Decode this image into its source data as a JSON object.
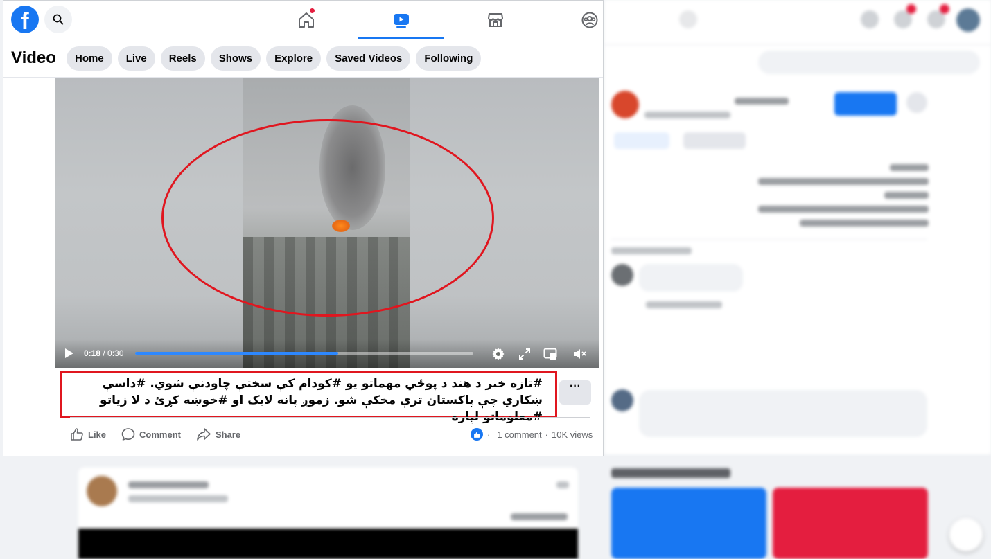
{
  "topnav": {
    "logo": "f",
    "icons": [
      "facebook-logo",
      "search-icon",
      "home-icon",
      "video-icon",
      "marketplace-icon",
      "groups-icon"
    ]
  },
  "subnav": {
    "title": "Video",
    "pills": [
      "Home",
      "Live",
      "Reels",
      "Shows",
      "Explore",
      "Saved Videos",
      "Following"
    ]
  },
  "player": {
    "current_time": "0:18",
    "separator": " / ",
    "duration": "0:30",
    "progress": 0.6
  },
  "post": {
    "caption": "#تازه خبر د هند د پوځي مهماتو يو #کودام کې سختې چاودنې شوي. #داسې ښکاري چې پاکستان ترې مخکې شو. زموږ پانه لايک او #خوښه کړئ د لا زياتو #معلوماتو لپاره",
    "more": "···",
    "actions": {
      "like": "Like",
      "comment": "Comment",
      "share": "Share"
    },
    "stats": {
      "comments": "1 comment",
      "views": "10K views",
      "dot": "·"
    }
  },
  "colors": {
    "brand_blue": "#1877f2",
    "highlight_red": "#e0161f",
    "notification_red": "#e41e3f"
  }
}
